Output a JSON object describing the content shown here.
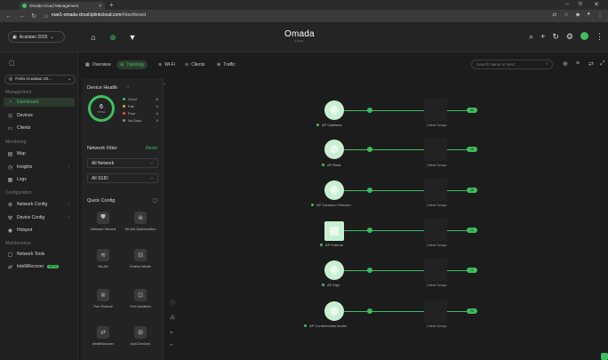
{
  "browser": {
    "tab_title": "Omada Cloud Management",
    "url_prefix": "euw1-omada-cloud.tplinkcloud.com",
    "url_path": "/#dashboard",
    "new_tab": "+",
    "minimize": "–",
    "maximize": "o",
    "close": "✕"
  },
  "header": {
    "site": "Acuistan 2025",
    "brand": "Omada",
    "brand_sub": "by tp-link"
  },
  "sidebar": {
    "site": "Forlo Acuistan 20...",
    "sections": {
      "management": "Management",
      "monitoring": "Monitoring",
      "configuration": "Configuration",
      "maintenance": "Maintenance"
    },
    "items": {
      "dashboard": "Dashboard",
      "devices": "Devices",
      "clients": "Clients",
      "map": "Map",
      "insights": "Insights",
      "logs": "Logs",
      "network_config": "Network Config",
      "device_config": "Device Config",
      "hotspot": "Hotspot",
      "network_tools": "Network Tools",
      "intellirecover": "IntelliRecover",
      "beta": "BETA"
    }
  },
  "toolbar": {
    "overview": "Overview",
    "topology": "Topology",
    "wifi": "Wi-Fi",
    "clients": "Clients",
    "traffic": "Traffic",
    "search_placeholder": "Search Name or MAC"
  },
  "panel": {
    "device_health": "Device Health",
    "total_count": "6",
    "total_label": "TOTAL",
    "legend": [
      {
        "label": "Good",
        "value": "6",
        "color": "#3fbf5f"
      },
      {
        "label": "Fair",
        "value": "0",
        "color": "#e0b030"
      },
      {
        "label": "Poor",
        "value": "0",
        "color": "#e05050"
      },
      {
        "label": "No Data",
        "value": "0",
        "color": "#888888"
      }
    ],
    "network_filter": "Network Filter",
    "reset": "Reset",
    "all_network": "All Network",
    "all_ssid": "All SSID",
    "quick_config": "Quick Config",
    "quick": [
      {
        "label": "Network Wizard",
        "icon": "wizard-icon"
      },
      {
        "label": "WLAN Optimization",
        "icon": "optimize-icon"
      },
      {
        "label": "WLAN",
        "icon": "wifi-icon"
      },
      {
        "label": "Extend Mode",
        "icon": "extend-icon"
      },
      {
        "label": "Port Reboot",
        "icon": "reboot-icon"
      },
      {
        "label": "Port Isolation",
        "icon": "lock-icon"
      },
      {
        "label": "IntelliRecover",
        "icon": "recover-icon"
      },
      {
        "label": "Add Devices",
        "icon": "add-icon"
      }
    ]
  },
  "topology": {
    "aps": [
      {
        "name": "AP Cafeteria",
        "count": "96"
      },
      {
        "name": "AP Rack",
        "count": "15"
      },
      {
        "name": "AP Carrasco Telecom",
        "count": "38"
      },
      {
        "name": "AP Exterior",
        "count": "12"
      },
      {
        "name": "AP Zayi",
        "count": "9"
      },
      {
        "name": "AP Conferencias Acuist",
        "count": "26"
      }
    ],
    "client_group": "Client Group"
  }
}
